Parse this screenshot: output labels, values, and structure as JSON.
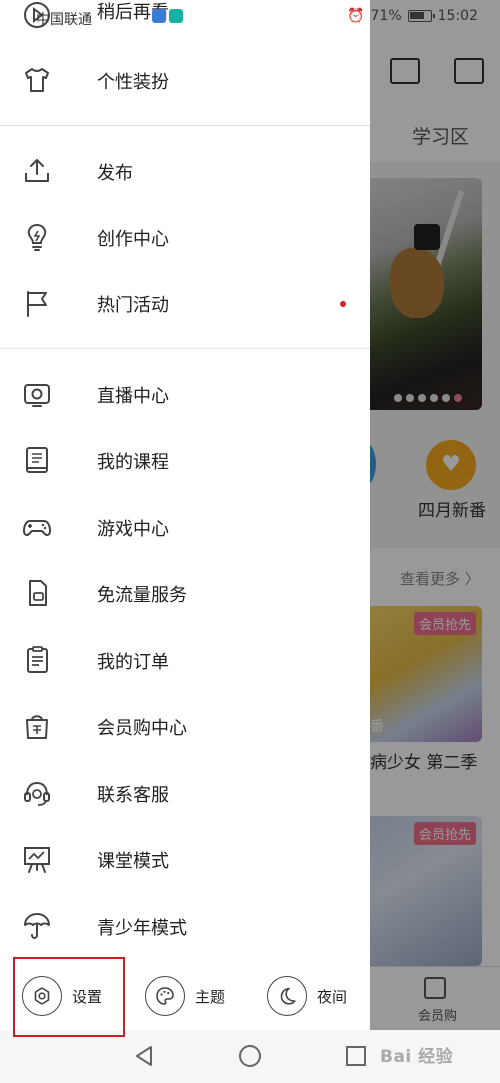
{
  "status_bar": {
    "carrier": "中国联通",
    "alarm": "⏰",
    "battery_percent": "71%",
    "time": "15:02"
  },
  "background_app": {
    "tab_label": "学习区",
    "favorite_label": "四月新番",
    "see_more": "查看更多 〉",
    "card_badge": "会员抢先",
    "card_overlay": "番",
    "card_title": "病少女 第二季",
    "shop_label": "会员购"
  },
  "drawer": {
    "partial_top_label": "稍后再看",
    "items": [
      {
        "label": "个性装扮",
        "icon": "tshirt-icon"
      },
      {
        "label": "发布",
        "icon": "upload-icon"
      },
      {
        "label": "创作中心",
        "icon": "lightbulb-icon"
      },
      {
        "label": "热门活动",
        "icon": "flag-icon"
      },
      {
        "label": "直播中心",
        "icon": "live-tv-icon"
      },
      {
        "label": "我的课程",
        "icon": "course-book-icon"
      },
      {
        "label": "游戏中心",
        "icon": "gamepad-icon"
      },
      {
        "label": "免流量服务",
        "icon": "sim-card-icon"
      },
      {
        "label": "我的订单",
        "icon": "order-list-icon"
      },
      {
        "label": "会员购中心",
        "icon": "shopping-bag-icon"
      },
      {
        "label": "联系客服",
        "icon": "headset-icon"
      },
      {
        "label": "课堂模式",
        "icon": "classroom-icon"
      },
      {
        "label": "青少年模式",
        "icon": "umbrella-icon"
      }
    ],
    "bottom": {
      "settings_label": "设置",
      "theme_label": "主题",
      "night_label": "夜间"
    }
  },
  "colors": {
    "highlight_border": "#c82020",
    "red_dot": "#e02020",
    "dim_overlay": "rgba(0,0,0,0.40)"
  },
  "watermark": "Bai 经验"
}
